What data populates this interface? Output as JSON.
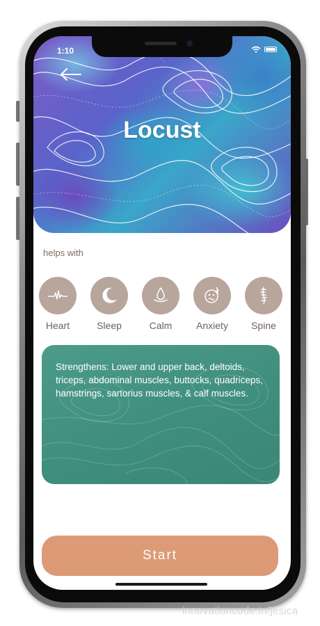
{
  "status_bar": {
    "time": "1:10"
  },
  "hero": {
    "title": "Locust",
    "back_icon": "arrow-left-icon"
  },
  "helps_with": {
    "label": "helps with",
    "items": [
      {
        "label": "Heart",
        "icon": "heartbeat-icon"
      },
      {
        "label": "Sleep",
        "icon": "moon-icon"
      },
      {
        "label": "Calm",
        "icon": "droplet-icon"
      },
      {
        "label": "Anxiety",
        "icon": "anxious-face-icon"
      },
      {
        "label": "Spine",
        "icon": "spine-icon"
      }
    ]
  },
  "info_card": {
    "text": "Strengthens: Lower and upper back, deltoids, triceps, abdominal muscles, buttocks, quadriceps, hamstrings, sartorius muscles, & calf muscles."
  },
  "start_button": {
    "label": "Start"
  },
  "watermark": "innovationcode.in/jesica",
  "colors": {
    "accent_button": "#dc9b76",
    "card_green": "#4d9b8a",
    "icon_circle": "#b8a59c",
    "label_text": "#7d6b63"
  }
}
